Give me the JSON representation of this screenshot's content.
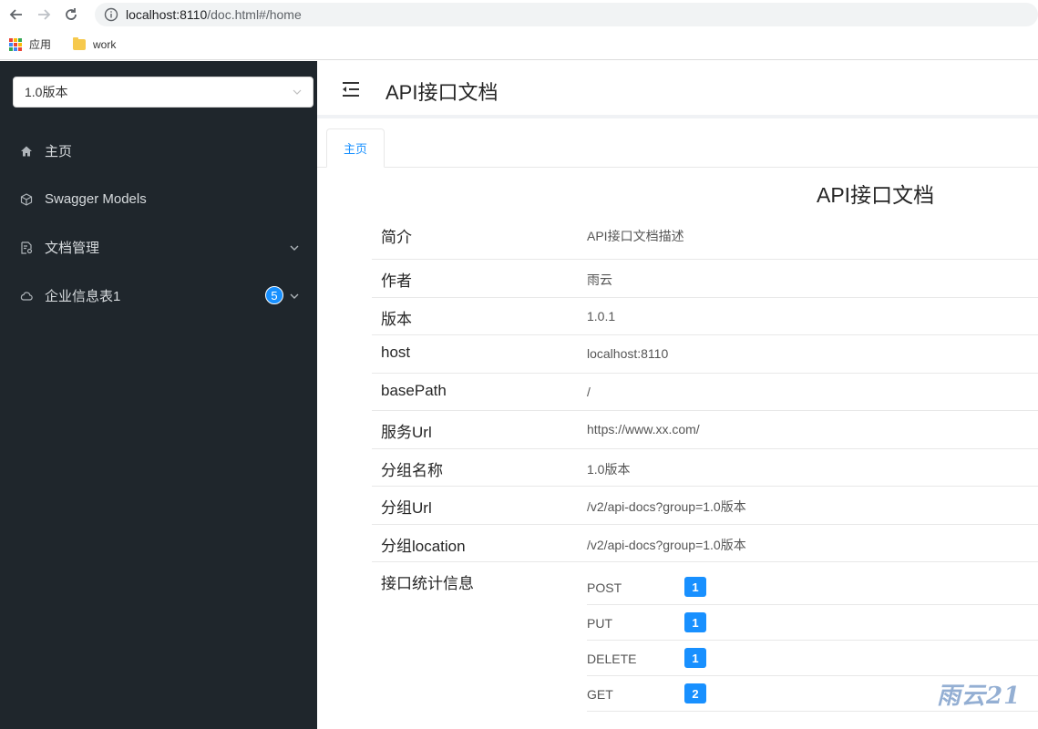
{
  "browser": {
    "url_host": "localhost:8110",
    "url_path": "/doc.html#/home",
    "bookmarks": [
      {
        "label": "应用"
      },
      {
        "label": "work"
      }
    ]
  },
  "sidebar": {
    "group_select": "1.0版本",
    "items": [
      {
        "label": "主页",
        "icon": "home-icon"
      },
      {
        "label": "Swagger Models",
        "icon": "cube-icon"
      },
      {
        "label": "文档管理",
        "icon": "document-settings-icon"
      },
      {
        "label": "企业信息表1",
        "icon": "cloud-icon",
        "badge": "5"
      }
    ]
  },
  "header": {
    "title": "API接口文档"
  },
  "tabs": [
    {
      "label": "主页"
    }
  ],
  "doc": {
    "title": "API接口文档",
    "rows": [
      {
        "key": "简介",
        "value": "API接口文档描述"
      },
      {
        "key": "作者",
        "value": "雨云"
      },
      {
        "key": "版本",
        "value": "1.0.1"
      },
      {
        "key": "host",
        "value": "localhost:8110"
      },
      {
        "key": "basePath",
        "value": "/"
      },
      {
        "key": "服务Url",
        "value": "https://www.xx.com/"
      },
      {
        "key": "分组名称",
        "value": "1.0版本"
      },
      {
        "key": "分组Url",
        "value": "/v2/api-docs?group=1.0版本"
      },
      {
        "key": "分组location",
        "value": "/v2/api-docs?group=1.0版本"
      }
    ],
    "stats_label": "接口统计信息",
    "stats": [
      {
        "method": "POST",
        "count": "1"
      },
      {
        "method": "PUT",
        "count": "1"
      },
      {
        "method": "DELETE",
        "count": "1"
      },
      {
        "method": "GET",
        "count": "2"
      }
    ]
  },
  "watermark": "雨云21",
  "colors": {
    "sidebar_bg": "#1f262c",
    "accent": "#1890ff"
  }
}
